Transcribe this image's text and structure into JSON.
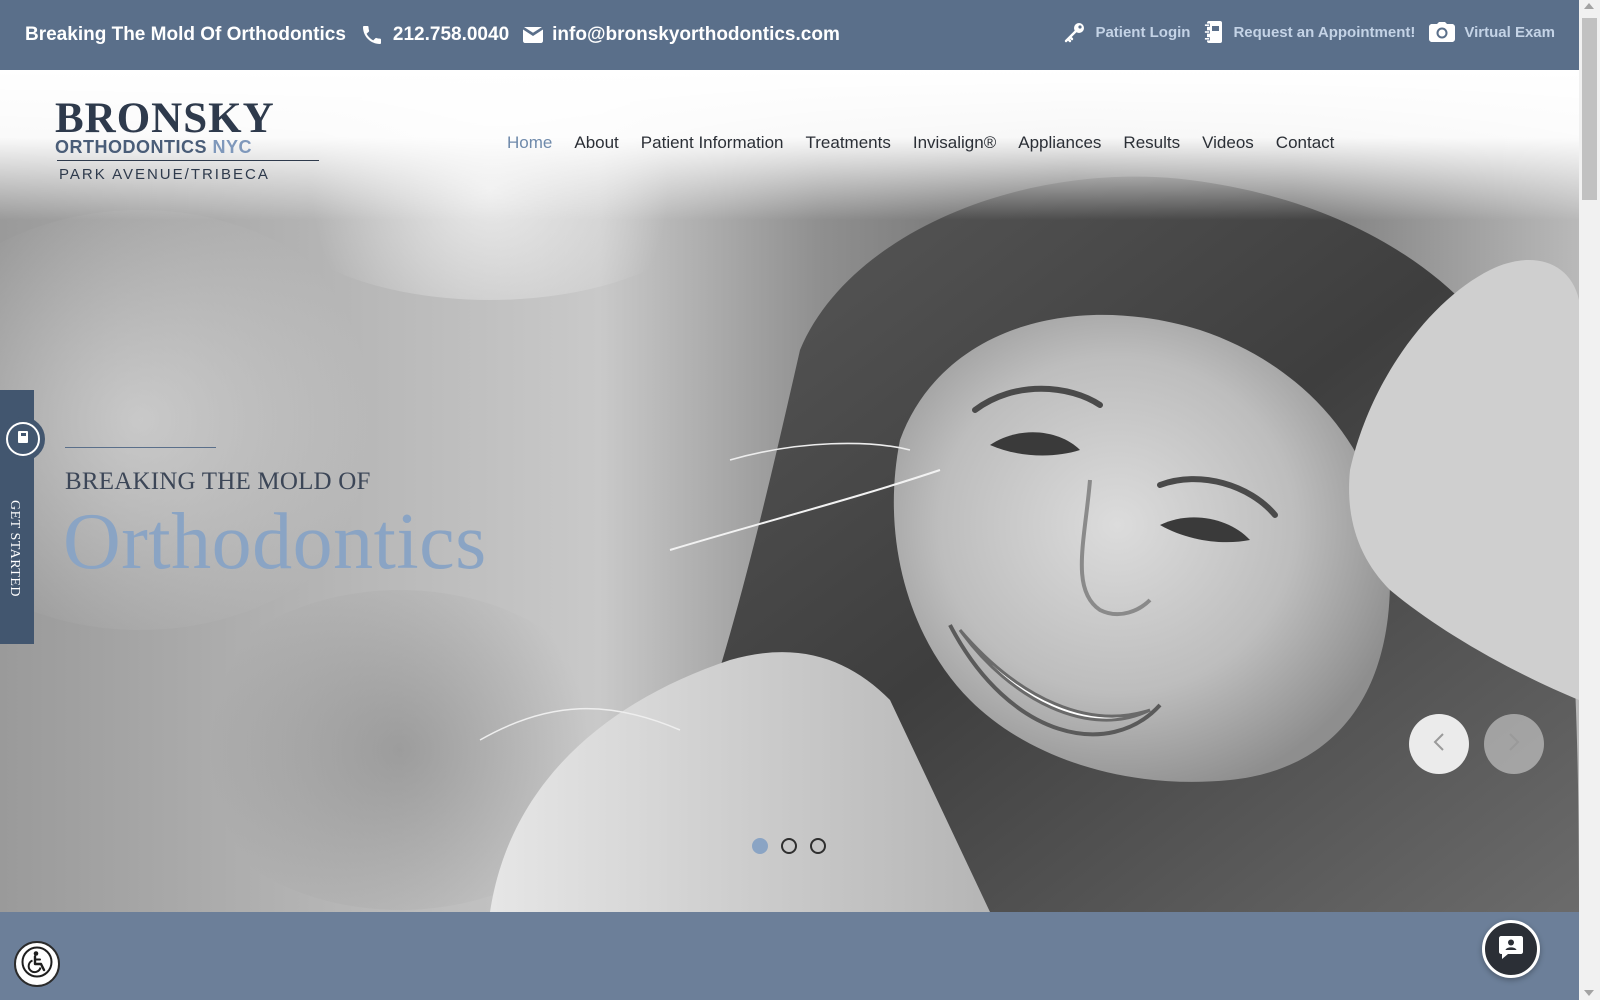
{
  "topbar": {
    "tagline": "Breaking The Mold Of Orthodontics",
    "phone": "212.758.0040",
    "email": "info@bronskyorthodontics.com",
    "links": [
      {
        "label": "Patient Login",
        "icon": "key-icon"
      },
      {
        "label": "Request an Appointment!",
        "icon": "appointment-icon"
      },
      {
        "label": "Virtual Exam",
        "icon": "camera-icon"
      }
    ]
  },
  "logo": {
    "name": "BRONSKY",
    "sub_primary": "ORTHODONTICS",
    "sub_accent": "NYC",
    "locations": "PARK AVENUE/TRIBECA"
  },
  "nav": {
    "items": [
      "Home",
      "About",
      "Patient Information",
      "Treatments",
      "Invisalign®",
      "Appliances",
      "Results",
      "Videos",
      "Contact"
    ],
    "active": "Home"
  },
  "side_tab": {
    "label": "GET STARTED",
    "icon": "notebook-icon"
  },
  "hero": {
    "kicker": "BREAKING THE MOLD OF",
    "title": "Orthodontics",
    "slide_count": 3,
    "active_slide": 1
  },
  "controls": {
    "prev_icon": "chevron-left-icon",
    "next_icon": "chevron-right-icon"
  },
  "widgets": {
    "accessibility_icon": "wheelchair-icon",
    "chat_icon": "chat-icon"
  },
  "colors": {
    "topbar_bg": "#5a6f8a",
    "accent": "#8aa4c4",
    "nav_active": "#6f8aab",
    "band_bg": "#6c7f99",
    "side_tab_bg": "#42566f"
  }
}
